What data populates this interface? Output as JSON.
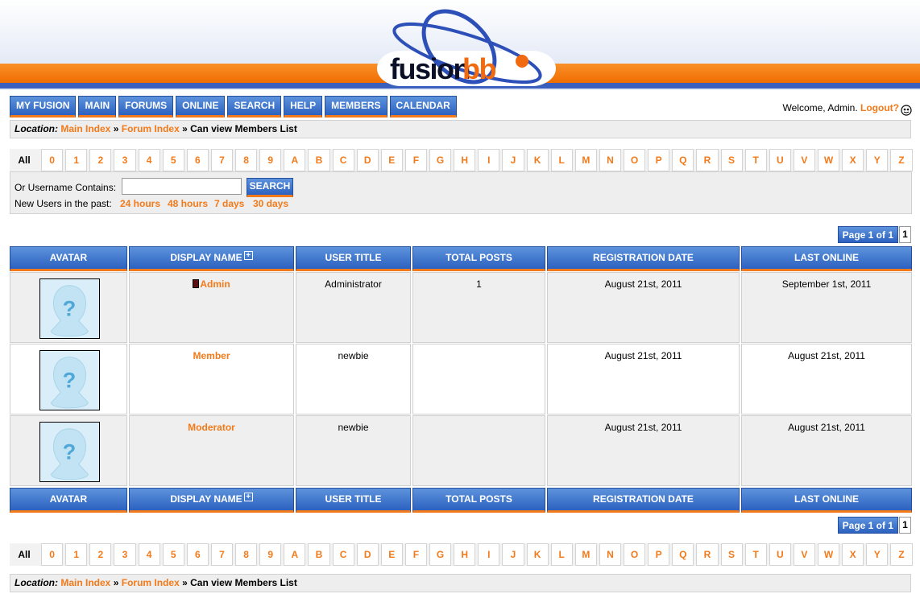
{
  "header": {
    "logo_text_1": "fusion",
    "logo_text_2": "bb"
  },
  "nav": {
    "items": [
      "MY FUSION",
      "MAIN",
      "FORUMS",
      "ONLINE",
      "SEARCH",
      "HELP",
      "MEMBERS",
      "CALENDAR"
    ]
  },
  "welcome": {
    "text": "Welcome, Admin.",
    "logout": "Logout?"
  },
  "location": {
    "label": "Location:",
    "crumb1": "Main Index",
    "sep": "»",
    "crumb2": "Forum Index",
    "current": "Can view Members List"
  },
  "letters": [
    "All",
    "0",
    "1",
    "2",
    "3",
    "4",
    "5",
    "6",
    "7",
    "8",
    "9",
    "A",
    "B",
    "C",
    "D",
    "E",
    "F",
    "G",
    "H",
    "I",
    "J",
    "K",
    "L",
    "M",
    "N",
    "O",
    "P",
    "Q",
    "R",
    "S",
    "T",
    "U",
    "V",
    "W",
    "X",
    "Y",
    "Z"
  ],
  "search": {
    "label": "Or Username Contains:",
    "button": "SEARCH",
    "value": "",
    "newusers_label": "New Users in the past:",
    "periods": [
      "24 hours",
      "48 hours",
      "7 days",
      "30 days"
    ]
  },
  "pager": {
    "label": "Page 1 of 1",
    "page": "1"
  },
  "table": {
    "headers": [
      "AVATAR",
      "DISPLAY NAME",
      "USER TITLE",
      "TOTAL POSTS",
      "REGISTRATION DATE",
      "LAST ONLINE"
    ],
    "sort_icon": "+",
    "rows": [
      {
        "name": "Admin",
        "title": "Administrator",
        "posts": "1",
        "registered": "August 21st, 2011",
        "last_online": "September 1st, 2011"
      },
      {
        "name": "Member",
        "title": "newbie",
        "posts": "",
        "registered": "August 21st, 2011",
        "last_online": "August 21st, 2011"
      },
      {
        "name": "Moderator",
        "title": "newbie",
        "posts": "",
        "registered": "August 21st, 2011",
        "last_online": "August 21st, 2011"
      }
    ]
  },
  "colors": {
    "accent": "#f27a1a",
    "nav_blue": "#3a6fcb",
    "header_blue": "#3b5fbd"
  },
  "icons": {
    "avatar": "unknown-user-avatar-icon",
    "admin": "admin-badge-icon",
    "welcome": "user-status-icon"
  }
}
